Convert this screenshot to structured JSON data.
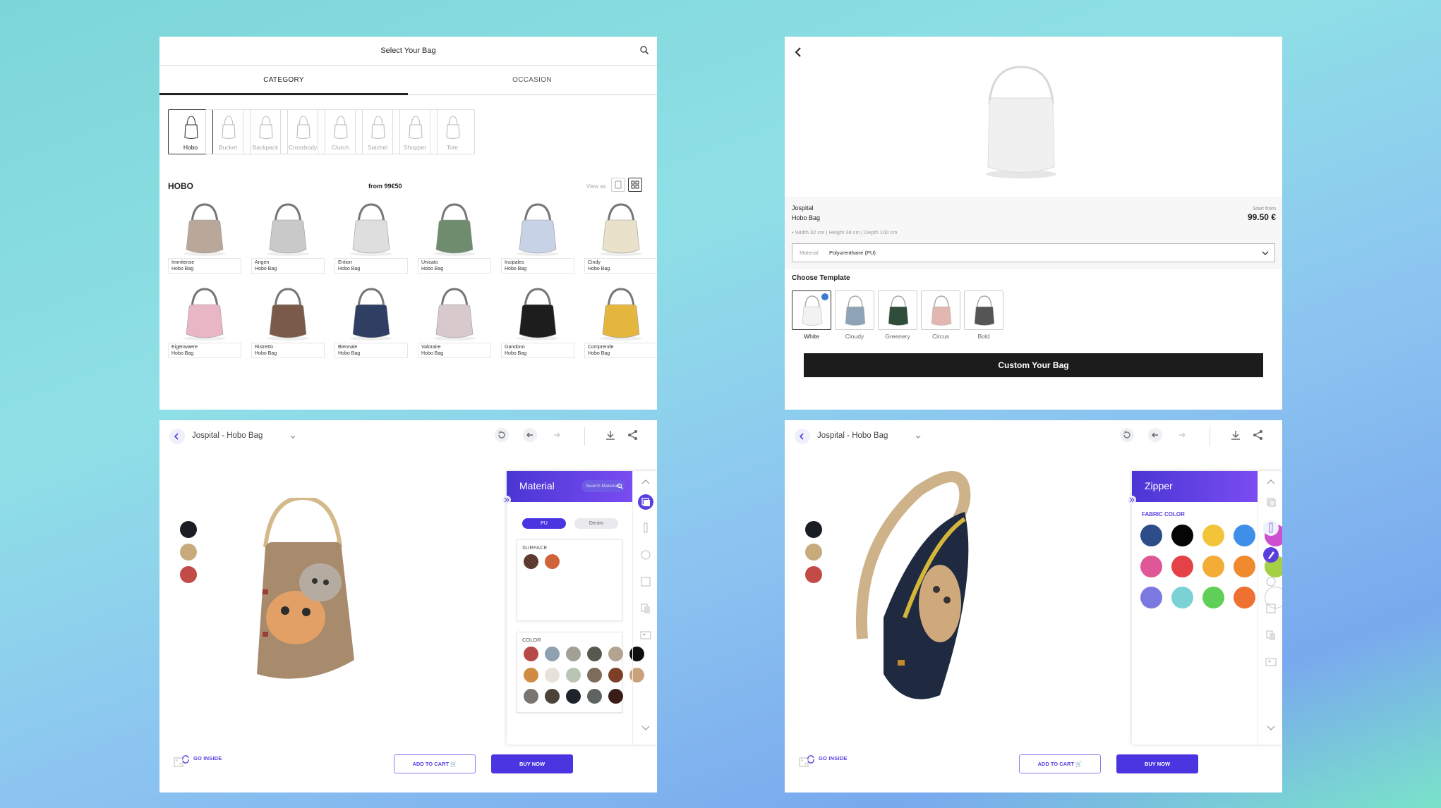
{
  "select_bag": {
    "title": "Select Your Bag",
    "tabs": [
      {
        "label": "CATEGORY"
      },
      {
        "label": "OCCASION"
      }
    ],
    "categories": [
      {
        "label": "Hobo"
      },
      {
        "label": "Bucket"
      },
      {
        "label": "Backpack"
      },
      {
        "label": "Crossbody"
      },
      {
        "label": "Clutch"
      },
      {
        "label": "Satchel"
      },
      {
        "label": "Shopper"
      },
      {
        "label": "Tote"
      }
    ],
    "section_title": "HOBO",
    "from_price": "from 99€50",
    "view_as": "View as",
    "products": [
      {
        "name": "Immitense",
        "type": "Hobo Bag",
        "color": "#b9a79a"
      },
      {
        "name": "Angen",
        "type": "Hobo Bag",
        "color": "#c9c9c9"
      },
      {
        "name": "Ention",
        "type": "Hobo Bag",
        "color": "#dedede"
      },
      {
        "name": "Unicato",
        "type": "Hobo Bag",
        "color": "#6f8c6e"
      },
      {
        "name": "Incipales",
        "type": "Hobo Bag",
        "color": "#c8d2e6"
      },
      {
        "name": "Cindy",
        "type": "Hobo Bag",
        "color": "#e9e1c9"
      },
      {
        "name": "Eigenwaere",
        "type": "Hobo Bag",
        "color": "#e9b6c5"
      },
      {
        "name": "Ristretto",
        "type": "Hobo Bag",
        "color": "#7a5b4a"
      },
      {
        "name": "Biennale",
        "type": "Hobo Bag",
        "color": "#2e3f63"
      },
      {
        "name": "Valoraire",
        "type": "Hobo Bag",
        "color": "#d7c9cc"
      },
      {
        "name": "Gandono",
        "type": "Hobo Bag",
        "color": "#1d1d1d"
      },
      {
        "name": "Comprende",
        "type": "Hobo Bag",
        "color": "#e4b63e"
      }
    ]
  },
  "product_detail": {
    "brand": "Jospital",
    "bag_type": "Hobo Bag",
    "dimensions": "• Width 32 cm  |  Height 38 cm  |  Depth 100 cm",
    "start_from": "Start from",
    "price": "99.50 €",
    "material_label": "Material",
    "material_value": "Polyurenthane (PU)",
    "choose_template": "Choose Template",
    "templates": [
      {
        "label": "White",
        "color": "#f2f2f2"
      },
      {
        "label": "Cloudy",
        "color": "#8fa3b7"
      },
      {
        "label": "Greenery",
        "color": "#2f4d38"
      },
      {
        "label": "Circus",
        "color": "#e3b7b1"
      },
      {
        "label": "Bold",
        "color": "#555555"
      }
    ],
    "cta": "Custom Your Bag"
  },
  "editor_material": {
    "title": "Jospital - Hobo Bag",
    "swatches": [
      "#1b1d24",
      "#c8ab7d",
      "#c24a47"
    ],
    "panel_title": "Material",
    "search_placeholder": "Search Materials",
    "pills": [
      {
        "label": "PU"
      },
      {
        "label": "Denim"
      }
    ],
    "surface_label": "SURFACE",
    "surface": [
      "#6a4437",
      "#d0633a"
    ],
    "color_label": "COLOR",
    "colors": [
      "#b84949",
      "#8ea1b1",
      "#a29f94",
      "#57584f",
      "#b3a492",
      "#0e0e0e",
      "#d08c43",
      "#e8e1d7",
      "#b9c4b4",
      "#7e6c5a",
      "#7d4026",
      "#c9a27c",
      "#7a7570",
      "#4b433a",
      "#1f232b",
      "#5f6460",
      "#3b1d18"
    ],
    "go_inside": "GO INSIDE",
    "add_to_cart": "ADD TO CART",
    "buy_now": "BUY NOW"
  },
  "editor_zipper": {
    "title": "Jospital - Hobo Bag",
    "swatches": [
      "#1b1d24",
      "#c8ab7d",
      "#c24a47"
    ],
    "panel_title": "Zipper",
    "fabric_label": "FABRIC COLOR",
    "colors": [
      "#2d4d8a",
      "#050505",
      "#f3c43a",
      "#3f8ee8",
      "#cc4fcf",
      "#e05797",
      "#e54248",
      "#f2ac37",
      "#ef8a2f",
      "#a5cf45",
      "#7b78e2",
      "#7bd2d5",
      "#5fcf58",
      "#ef7131",
      "#ffffff"
    ],
    "go_inside": "GO INSIDE",
    "add_to_cart": "ADD TO CART",
    "buy_now": "BUY NOW"
  }
}
